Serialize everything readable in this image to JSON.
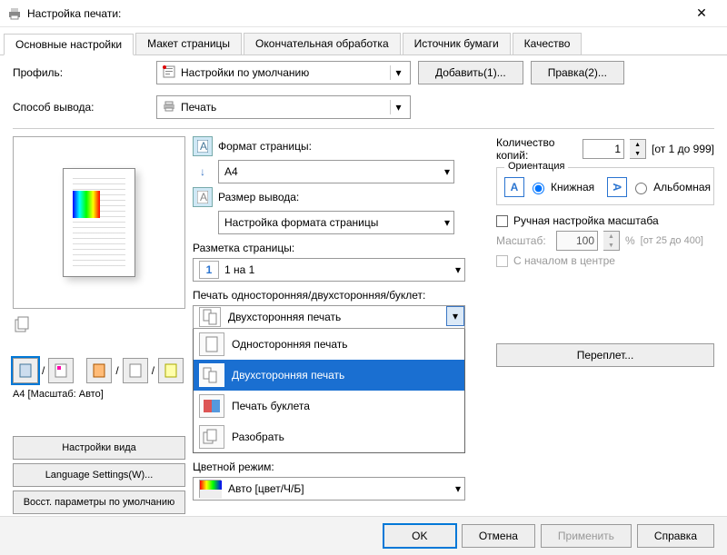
{
  "window": {
    "title": "Настройка печати:"
  },
  "tabs": [
    "Основные настройки",
    "Макет страницы",
    "Окончательная обработка",
    "Источник бумаги",
    "Качество"
  ],
  "profile": {
    "label": "Профиль:",
    "value": "Настройки по умолчанию",
    "add": "Добавить(1)...",
    "edit": "Правка(2)..."
  },
  "output": {
    "label": "Способ вывода:",
    "value": "Печать"
  },
  "preview": {
    "status": "A4 [Масштаб: Авто]"
  },
  "left_buttons": {
    "view": "Настройки вида",
    "lang": "Language Settings(W)...",
    "restore": "Восст. параметры по умолчанию"
  },
  "page_format": {
    "label": "Формат страницы:",
    "value": "A4"
  },
  "output_size": {
    "label": "Размер вывода:",
    "value": "Настройка формата страницы"
  },
  "layout": {
    "label": "Разметка страницы:",
    "value": "1 на 1",
    "badge": "1"
  },
  "duplex": {
    "label": "Печать односторонняя/двухсторонняя/буклет:",
    "selected": "Двухсторонняя печать",
    "options": [
      "Односторонняя печать",
      "Двухсторонняя печать",
      "Печать буклета",
      "Разобрать"
    ]
  },
  "color_mode": {
    "label": "Цветной режим:",
    "value": "Авто [цвет/Ч/Б]"
  },
  "copies": {
    "label": "Количество копий:",
    "value": "1",
    "range": "[от 1 до 999]"
  },
  "orientation": {
    "legend": "Ориентация",
    "portrait": "Книжная",
    "landscape": "Альбомная"
  },
  "scale": {
    "manual": "Ручная настройка масштаба",
    "label": "Масштаб:",
    "value": "100",
    "unit": "%",
    "range": "[от 25 до 400]",
    "center": "С началом в центре"
  },
  "binding": {
    "button": "Переплет..."
  },
  "footer": {
    "ok": "OK",
    "cancel": "Отмена",
    "apply": "Применить",
    "help": "Справка"
  }
}
